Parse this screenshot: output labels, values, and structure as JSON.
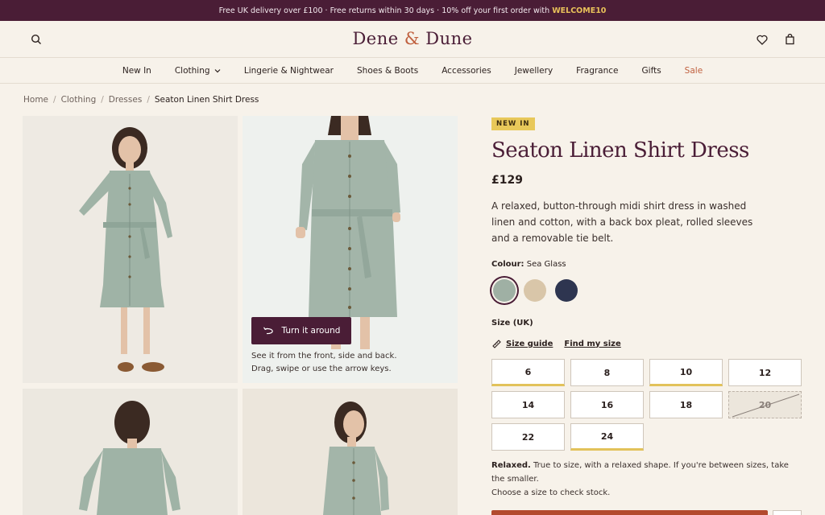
{
  "promo": {
    "text": "Free UK delivery over £100  ·  Free returns within 30 days  ·  10% off your first order with",
    "code": "WELCOME10"
  },
  "header": {
    "logo_left": "Dene",
    "logo_amp": "&",
    "logo_right": "Dune",
    "icons": [
      "search-icon",
      "heart-icon",
      "bag-icon"
    ]
  },
  "nav": {
    "items": [
      "New In",
      "Clothing",
      "Lingerie & Nightwear",
      "Shoes & Boots",
      "Accessories",
      "Jewellery",
      "Fragrance",
      "Gifts",
      "Sale"
    ]
  },
  "breadcrumb": [
    "Home",
    "Clothing",
    "Dresses",
    "Seaton Linen Shirt Dress"
  ],
  "gallery": {
    "turn_button": "Turn it around",
    "turn_help_1": "See it from the front, side and back.",
    "turn_help_2": "Drag, swipe or use the arrow keys."
  },
  "product": {
    "badge": "NEW IN",
    "title": "Seaton Linen Shirt Dress",
    "price": "£129",
    "description": "A relaxed, button-through midi shirt dress in washed linen and cotton, with a back box pleat, rolled sleeves and a removable tie belt.",
    "colour_label": "Colour:",
    "colour_value": "Sea Glass",
    "swatches": [
      "#9fb0a4",
      "#d9c6a9",
      "#2e3550"
    ],
    "size_label": "Size (UK)",
    "size_guide": "Size guide",
    "find_size": "Find my size",
    "sizes": [
      "6",
      "8",
      "10",
      "12",
      "14",
      "16",
      "18",
      "20",
      "22",
      "24"
    ],
    "fit_label": "Relaxed.",
    "fit_text": "True to size, with a relaxed shape. If you're between sizes, take the smaller.",
    "stock_text": "Choose a size to check stock."
  },
  "colors": {
    "brand": "#4a1d36",
    "accent": "#c0603f",
    "badge": "#e8c85a",
    "cta": "#b34a2e"
  }
}
